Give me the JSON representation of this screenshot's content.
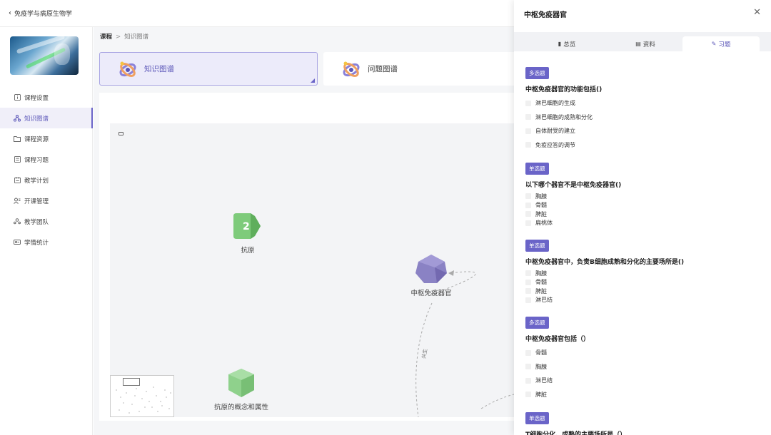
{
  "header": {
    "back_label": "免疫学与病原生物学"
  },
  "sidebar": {
    "items": [
      {
        "label": "课程设置",
        "icon": "info-square-icon"
      },
      {
        "label": "知识图谱",
        "icon": "graph-icon",
        "active": true
      },
      {
        "label": "课程资源",
        "icon": "folder-icon"
      },
      {
        "label": "课程习题",
        "icon": "list-icon"
      },
      {
        "label": "教学计划",
        "icon": "calendar-icon"
      },
      {
        "label": "开课管理",
        "icon": "manage-icon"
      },
      {
        "label": "教学团队",
        "icon": "team-icon"
      },
      {
        "label": "学情统计",
        "icon": "stats-icon"
      }
    ]
  },
  "breadcrumb": {
    "root": "课程",
    "separator": ">",
    "current": "知识图谱"
  },
  "cards": {
    "knowledge": "知识图谱",
    "problem": "问题图谱"
  },
  "graph": {
    "nodes": [
      {
        "label": "抗原",
        "badge": "2"
      },
      {
        "label": "中枢免疫器官"
      },
      {
        "label": "抗原的概念和属性"
      }
    ],
    "edge_label": "共生"
  },
  "drawer": {
    "title": "中枢免疫器官",
    "tabs": [
      "总览",
      "资料",
      "习题"
    ],
    "active_tab": "习题",
    "questions": [
      {
        "type": "多选题",
        "title": "中枢免疫器官的功能包括()",
        "options": [
          "淋巴细胞的生成",
          "淋巴细胞的成熟和分化",
          "自体耐受的建立",
          "免疫应答的调节"
        ]
      },
      {
        "type": "单选题",
        "title": "以下哪个器官不是中枢免疫器官()",
        "options": [
          "胸腺",
          "骨髓",
          "脾脏",
          "扁桃体"
        ]
      },
      {
        "type": "单选题",
        "title": "中枢免疫器官中，负责B细胞成熟和分化的主要场所是()",
        "options": [
          "胸腺",
          "骨髓",
          "脾脏",
          "淋巴结"
        ]
      },
      {
        "type": "多选题",
        "title": "中枢免疫器官包括（）",
        "options": [
          "骨髓",
          "胸腺",
          "淋巴结",
          "脾脏"
        ]
      },
      {
        "type": "单选题",
        "title": "T细胞分化、成熟的主要场所是（）",
        "options": []
      }
    ]
  },
  "colors": {
    "accent": "#6a64c8",
    "node_green": "#7ecb7b",
    "node_purple": "#8a82c4"
  }
}
